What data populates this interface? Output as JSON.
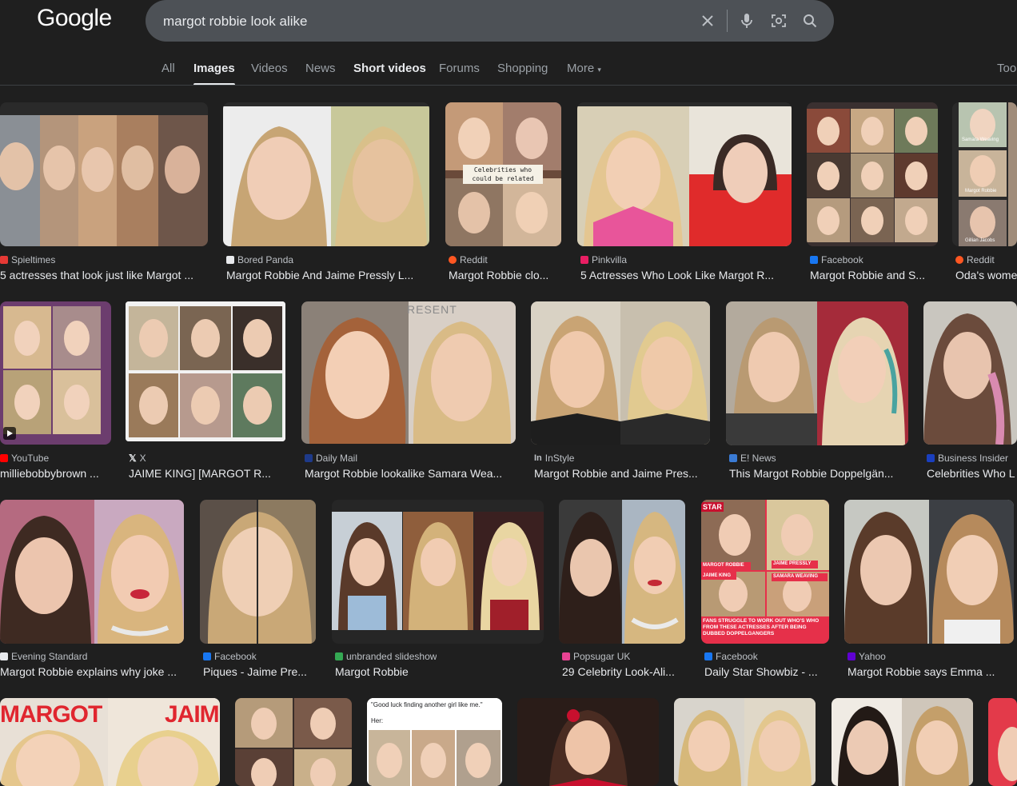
{
  "logo": "Google",
  "search": {
    "query": "margot robbie look alike"
  },
  "tabs": [
    {
      "label": "All"
    },
    {
      "label": "Images"
    },
    {
      "label": "Videos"
    },
    {
      "label": "News"
    },
    {
      "label": "Short videos"
    },
    {
      "label": "Forums"
    },
    {
      "label": "Shopping"
    },
    {
      "label": "More"
    },
    {
      "label": "Too"
    }
  ],
  "results": [
    {
      "source": "Spieltimes",
      "title": "5 actresses that look just like Margot ..."
    },
    {
      "source": "Bored Panda",
      "title": "Margot Robbie And Jaime Pressly L..."
    },
    {
      "source": "Reddit",
      "title": "Margot Robbie clo..."
    },
    {
      "source": "Pinkvilla",
      "title": "5 Actresses Who Look Like Margot R..."
    },
    {
      "source": "Facebook",
      "title": "Margot Robbie and S..."
    },
    {
      "source": "Reddit",
      "title": "Oda's wome"
    },
    {
      "source": "YouTube",
      "title": "milliebobbybrown ..."
    },
    {
      "source": "X",
      "title": "JAIME KING] [MARGOT R..."
    },
    {
      "source": "Daily Mail",
      "title": "Margot Robbie lookalike Samara Wea..."
    },
    {
      "source": "InStyle",
      "title": "Margot Robbie and Jaime Pres..."
    },
    {
      "source": "E! News",
      "title": "This Margot Robbie Doppelgän..."
    },
    {
      "source": "Business Insider",
      "title": "Celebrities Who L"
    },
    {
      "source": "Evening Standard",
      "title": "Margot Robbie explains why joke ..."
    },
    {
      "source": "Facebook",
      "title": "Piques - Jaime Pre..."
    },
    {
      "source": "unbranded slideshow",
      "title": "Margot Robbie"
    },
    {
      "source": "Popsugar UK",
      "title": "29 Celebrity Look-Ali..."
    },
    {
      "source": "Facebook",
      "title": "Daily Star Showbiz - ..."
    },
    {
      "source": "Yahoo",
      "title": "Margot Robbie says Emma ..."
    }
  ],
  "thumb_text": {
    "celebs_related": "Celebrities who could be related",
    "samara": "Samara Weaving",
    "margot": "Margot Robbie",
    "gillian": "Gillian Jacobs",
    "presented": "RESENT",
    "star": "STAR",
    "margot_label": "MARGOT ROBBIE",
    "jaime_pressly": "JAIME PRESSLY",
    "jaime_king": "JAIME KING",
    "samara_label": "SAMARA WEAVING",
    "fans_caption": "FANS STRUGGLE TO WORK OUT WHO'S WHO FROM THESE ACTRESSES AFTER BEING DUBBED DOPPELGANGERS",
    "margot_big": "MARGOT",
    "jaime_big": "JAIMI",
    "good_luck": "\"Good luck finding another girl like me.\"",
    "her": "Her:"
  },
  "colors": {
    "background": "#1f1f1f",
    "searchbar": "#4d5156",
    "text": "#e8eaed",
    "muted": "#9aa0a6"
  }
}
